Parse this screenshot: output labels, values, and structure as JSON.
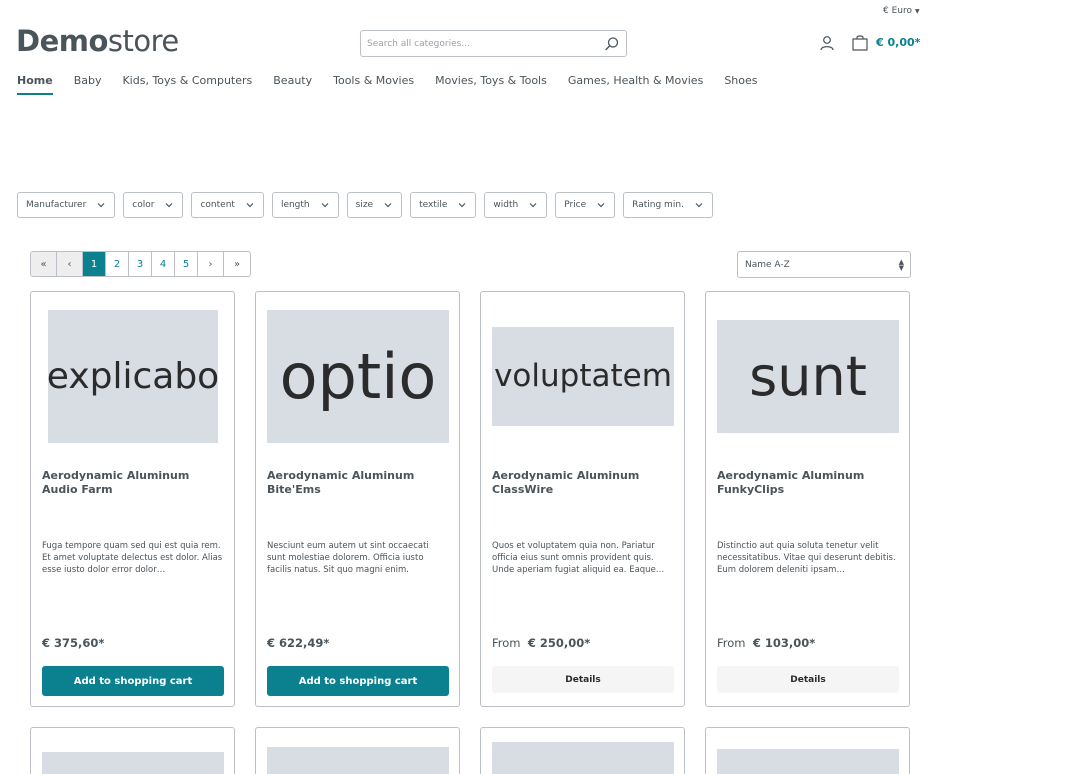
{
  "header": {
    "currency": "€ Euro",
    "logo_bold": "Demo",
    "logo_light": "store",
    "search_placeholder": "Search all categories...",
    "cart_total": "€ 0,00*"
  },
  "nav": {
    "items": [
      {
        "label": "Home",
        "active": true
      },
      {
        "label": "Baby"
      },
      {
        "label": "Kids, Toys & Computers"
      },
      {
        "label": "Beauty"
      },
      {
        "label": "Tools & Movies"
      },
      {
        "label": "Movies, Toys & Tools"
      },
      {
        "label": "Games, Health & Movies"
      },
      {
        "label": "Shoes"
      }
    ]
  },
  "filters": [
    "Manufacturer",
    "color",
    "content",
    "length",
    "size",
    "textile",
    "width",
    "Price",
    "Rating min."
  ],
  "pagination": {
    "first": "«",
    "prev": "‹",
    "pages": [
      "1",
      "2",
      "3",
      "4",
      "5"
    ],
    "current": "1",
    "next": "›",
    "last": "»"
  },
  "sort": {
    "selected": "Name A-Z"
  },
  "products": [
    {
      "image_text": "explicabo",
      "title": "Aerodynamic Aluminum Audio Farm",
      "description": "Fuga tempore quam sed qui est quia rem. Et amet voluptate delectus est dolor. Alias esse iusto dolor error dolor…",
      "price_prefix": "",
      "price": "€ 375,60*",
      "action": "Add to shopping cart"
    },
    {
      "image_text": "optio",
      "title": "Aerodynamic Aluminum Bite'Ems",
      "description": "Nesciunt eum autem ut sint occaecati sunt molestiae dolorem. Officia iusto facilis natus. Sit quo magni enim.",
      "price_prefix": "",
      "price": "€ 622,49*",
      "action": "Add to shopping cart"
    },
    {
      "image_text": "voluptatem",
      "title": "Aerodynamic Aluminum ClassWire",
      "description": "Quos et voluptatem quia non. Pariatur officia eius sunt omnis provident quis. Unde aperiam fugiat aliquid ea. Eaque…",
      "price_prefix": "From ",
      "price": "€ 250,00*",
      "action": "Details"
    },
    {
      "image_text": "sunt",
      "title": "Aerodynamic Aluminum FunkyClips",
      "description": "Distinctio aut quia soluta tenetur velit necessitatibus. Vitae qui deserunt debitis. Eum dolorem deleniti ipsam…",
      "price_prefix": "From ",
      "price": "€ 103,00*",
      "action": "Details"
    }
  ],
  "colors": {
    "accent": "#0b8190",
    "text": "#4a545b",
    "border": "#bcc1c7",
    "image_placeholder": "#d8dce3"
  },
  "icons": [
    "search-icon",
    "account-icon",
    "cart-icon",
    "chevron-down-icon"
  ]
}
